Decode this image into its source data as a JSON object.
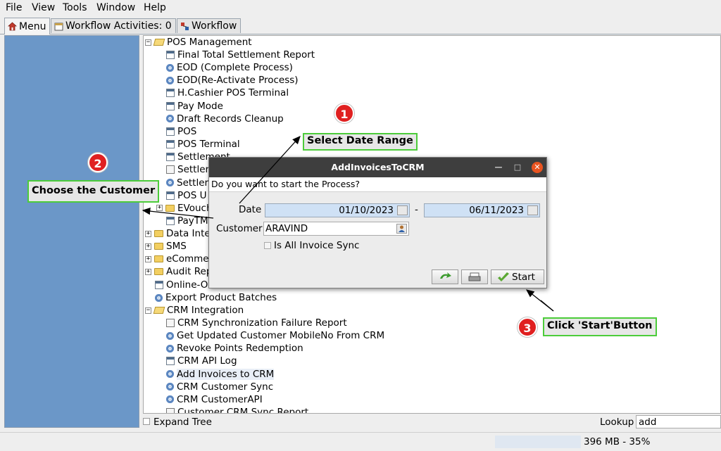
{
  "menubar": [
    "File",
    "View",
    "Tools",
    "Window",
    "Help"
  ],
  "tabs": [
    {
      "label": "Menu",
      "icon": "home-icon"
    },
    {
      "label": "Workflow Activities: 0",
      "icon": "calendar-icon"
    },
    {
      "label": "Workflow",
      "icon": "workflow-icon"
    }
  ],
  "tree": {
    "pos_management": "POS Management",
    "pos_items": [
      {
        "label": "Final Total Settlement Report",
        "icon": "report-icon"
      },
      {
        "label": "EOD (Complete Process)",
        "icon": "process-gear-icon"
      },
      {
        "label": "EOD(Re-Activate Process)",
        "icon": "process-gear-icon"
      },
      {
        "label": "H.Cashier POS Terminal",
        "icon": "report-icon"
      },
      {
        "label": "Pay Mode",
        "icon": "report-icon"
      },
      {
        "label": "Draft Records Cleanup",
        "icon": "process-gear-icon"
      },
      {
        "label": "POS",
        "icon": "report-icon"
      },
      {
        "label": "POS Terminal",
        "icon": "report-icon"
      },
      {
        "label": "Settlement",
        "icon": "report-icon"
      },
      {
        "label": "Settler",
        "icon": "document-icon"
      },
      {
        "label": "Settler",
        "icon": "process-gear-icon"
      },
      {
        "label": "POS U",
        "icon": "report-icon"
      },
      {
        "label": "EVouch",
        "icon": "folder-icon"
      },
      {
        "label": "PayTM",
        "icon": "report-icon"
      }
    ],
    "folders": [
      "Data Inte",
      "SMS",
      "eComme",
      "Audit Rep"
    ],
    "online": "Online-O",
    "export": "Export Product Batches",
    "crm_integration": "CRM Integration",
    "crm_items": [
      {
        "label": "CRM Synchronization Failure Report",
        "icon": "document-icon"
      },
      {
        "label": "Get Updated Customer MobileNo From CRM",
        "icon": "process-gear-icon"
      },
      {
        "label": "Revoke Points Redemption",
        "icon": "process-gear-icon"
      },
      {
        "label": "CRM API Log",
        "icon": "report-icon"
      },
      {
        "label": "Add Invoices to CRM",
        "icon": "process-gear-icon"
      },
      {
        "label": "CRM Customer Sync",
        "icon": "process-gear-icon"
      },
      {
        "label": "CRM CustomerAPI",
        "icon": "process-gear-icon"
      },
      {
        "label": "Customer CRM Sync Report",
        "icon": "document-icon"
      }
    ]
  },
  "bottom": {
    "expand_tree": "Expand Tree",
    "lookup_label": "Lookup",
    "lookup_value": "add"
  },
  "status": {
    "memory": "396 MB - 35%"
  },
  "dialog": {
    "title": "AddInvoicesToCRM",
    "prompt": "Do you want to start the Process?",
    "date_label": "Date",
    "date_from": "01/10/2023",
    "date_sep": "-",
    "date_to": "06/11/2023",
    "customer_label": "Customer",
    "customer_value": "ARAVIND",
    "checkbox_label": "Is All Invoice Sync",
    "start_label": "Start"
  },
  "callouts": [
    {
      "num": "1",
      "text": "Select Date Range"
    },
    {
      "num": "2",
      "text": "Choose the Customer"
    },
    {
      "num": "3",
      "text": "Click 'Start'Button"
    }
  ],
  "colors": {
    "left_panel": "#6b97c8",
    "dialog_title_bar": "#3e3e3e",
    "field_bg": "#cfe1f5",
    "callout_border": "#4ccc3a",
    "badge": "#e02020",
    "close_button": "#e95420"
  }
}
